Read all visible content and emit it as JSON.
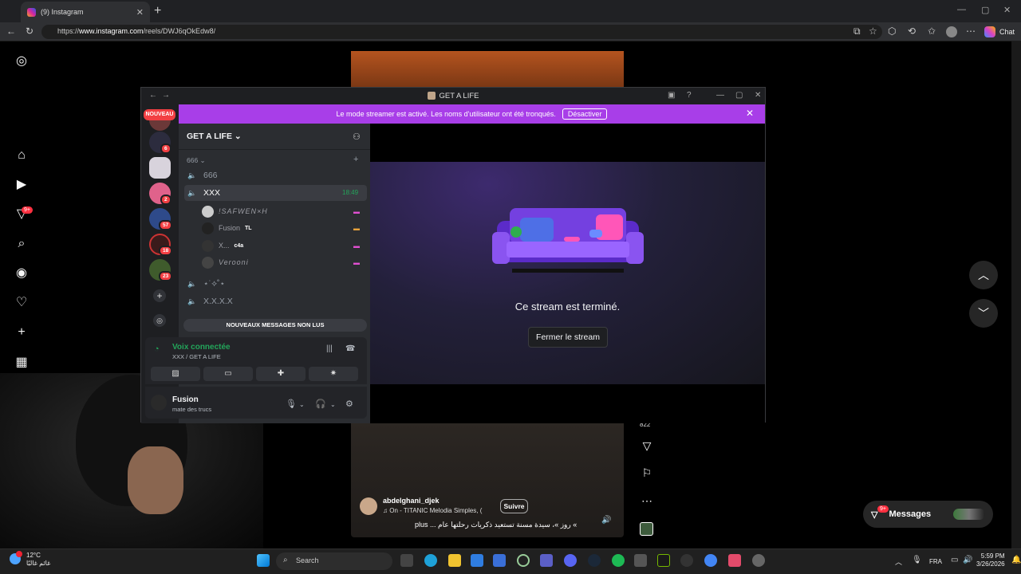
{
  "browser": {
    "tab_title": "(9) Instagram",
    "tab_close": "✕",
    "new_tab": "+",
    "url_prefix": "https://",
    "url_host": "www.instagram.com",
    "url_path": "/reels/DWJ6qOkEdw8/",
    "copilot_label": "Chat"
  },
  "instagram": {
    "sidebar_badge": "9+",
    "reel": {
      "username": "abdelghani_djek",
      "music": "On - TITANIC  Melodia Simples, (",
      "follow_label": "Suivre",
      "caption": "plus ... روز »، سيدة مسنة تستعيد ذكريات رحلتها عام «",
      "likes": "822"
    },
    "messages_label": "Messages",
    "messages_badge": "9+"
  },
  "discord": {
    "window_title": "GET A LIFE",
    "banner_text": "Le mode streamer est activé. Les noms d'utilisateur ont été tronqués.",
    "banner_button": "Désactiver",
    "nouveau": "NOUVEAU",
    "guild_badges": [
      "6",
      "2",
      "57",
      "18",
      "23"
    ],
    "server_name": "GET A LIFE",
    "category": "666",
    "channels": [
      {
        "name": "666"
      },
      {
        "name": "XXX",
        "time": "18:49"
      },
      {
        "name": "⋆˙⟡˚⋆"
      },
      {
        "name": "X.X.X.X"
      }
    ],
    "members": [
      {
        "name": "!SAFWEN×H",
        "tag": ""
      },
      {
        "name": "Fusion",
        "tag": "TL"
      },
      {
        "name": "X...",
        "tag": "c4a"
      },
      {
        "name": "Verooni",
        "tag": ""
      }
    ],
    "new_messages": "NOUVEAUX MESSAGES NON LUS",
    "voice_title": "Voix connectée",
    "voice_sub": "XXX / GET A LIFE",
    "user_name": "Fusion",
    "user_status": "mate des trucs",
    "stream_ended": "Ce stream est terminé.",
    "close_stream": "Fermer le stream"
  },
  "taskbar": {
    "temp": "12°C",
    "weather_sub": "غائم غالبًا",
    "search_placeholder": "Search",
    "lang": "FRA",
    "time": "5:59 PM",
    "date": "3/26/2026"
  }
}
